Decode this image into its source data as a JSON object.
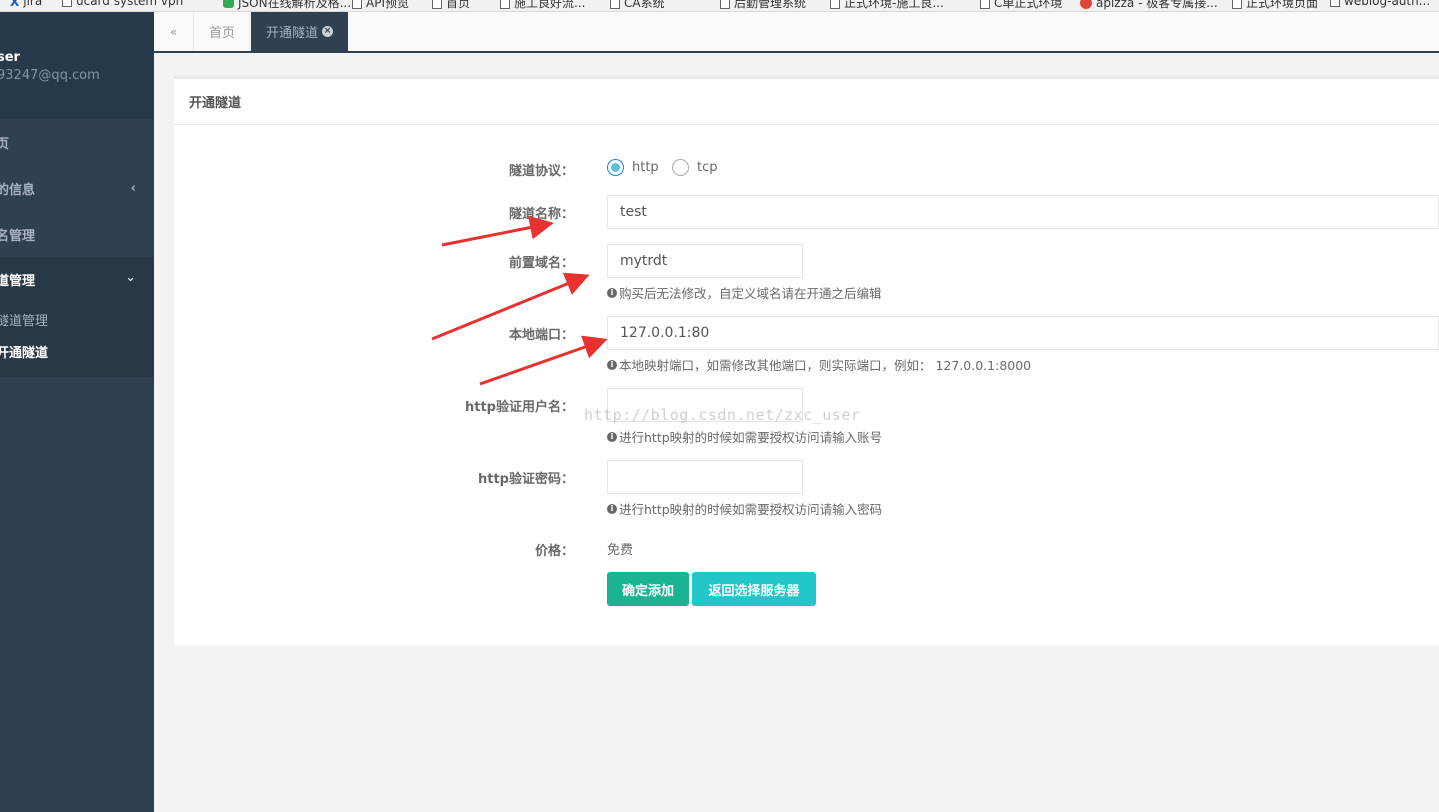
{
  "bookmarks": [
    {
      "icon": "app-icon-x",
      "label": "jira"
    },
    {
      "icon": "page-icon",
      "label": "ucard system vpn"
    },
    {
      "icon": "green-icon",
      "label": "JSON在线解析及格..."
    },
    {
      "icon": "page-icon",
      "label": "API预览"
    },
    {
      "icon": "page-icon",
      "label": "首页"
    },
    {
      "icon": "page-icon",
      "label": "施工良好流..."
    },
    {
      "icon": "page-icon",
      "label": "CA系统"
    },
    {
      "icon": "page-icon",
      "label": "后勤管理系统"
    },
    {
      "icon": "page-icon",
      "label": "正式环境-施工良..."
    },
    {
      "icon": "page-icon",
      "label": "C单正式环境"
    },
    {
      "icon": "red-icon",
      "label": "apizza - 极客专属接..."
    },
    {
      "icon": "page-icon",
      "label": "正式环境页面"
    },
    {
      "icon": "page-icon",
      "label": "weblog-auth..."
    }
  ],
  "sidebar": {
    "user_name": "ser",
    "user_email": "93247@qq.com",
    "items": [
      {
        "label": "页"
      },
      {
        "label": "的信息",
        "chevron": "‹"
      },
      {
        "label": "名管理"
      }
    ],
    "active_group": {
      "label": "道管理",
      "chevron": "⌄",
      "sub_items": [
        {
          "label": "隧道管理"
        },
        {
          "label": "开通隧道"
        }
      ]
    }
  },
  "tabs": {
    "back_icon": "«",
    "home": "首页",
    "active": "开通隧道",
    "close": "×"
  },
  "panel": {
    "title": "开通隧道"
  },
  "form": {
    "protocol_label": "隧道协议：",
    "protocol_options": [
      {
        "label": "http",
        "checked": true
      },
      {
        "label": "tcp",
        "checked": false
      }
    ],
    "name_label": "隧道名称：",
    "name_value": "test",
    "domain_label": "前置域名：",
    "domain_value": "mytrdt",
    "domain_help": "购买后无法修改，自定义域名请在开通之后编辑",
    "port_label": "本地端口：",
    "port_value": "127.0.0.1:80",
    "port_help": "本地映射端口，如需修改其他端口，则实际端口，例如： 127.0.0.1:8000",
    "auth_user_label": "http验证用户名：",
    "auth_user_value": "",
    "auth_user_help": "进行http映射的时候如需要授权访问请输入账号",
    "auth_pass_label": "http验证密码：",
    "auth_pass_value": "",
    "auth_pass_help": "进行http映射的时候如需要授权访问请输入密码",
    "price_label": "价格：",
    "price_value": "免费",
    "submit_button": "确定添加",
    "back_button": "返回选择服务器",
    "info_glyph": "i"
  },
  "watermark": "http://blog.csdn.net/zxc_user",
  "colors": {
    "sidebar_bg": "#2f4050",
    "primary": "#1ab394",
    "info": "#23c6c8",
    "annotation_arrow": "#e8322f"
  }
}
